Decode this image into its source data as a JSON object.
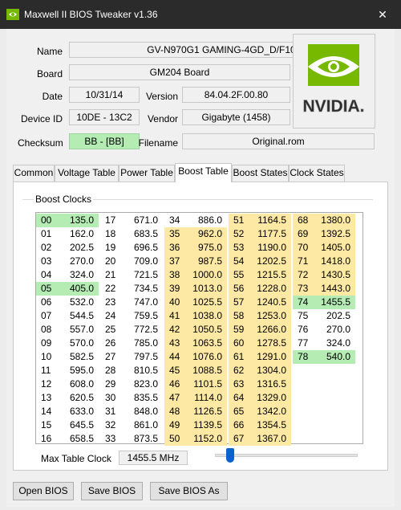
{
  "window": {
    "title": "Maxwell II BIOS Tweaker v1.36",
    "close_glyph": "✕"
  },
  "info": {
    "name_label": "Name",
    "name_value": "GV-N970G1 GAMING-4GD_D/F10",
    "board_label": "Board",
    "board_value": "GM204 Board",
    "date_label": "Date",
    "date_value": "10/31/14",
    "version_label": "Version",
    "version_value": "84.04.2F.00.80",
    "device_label": "Device ID",
    "device_value": "10DE - 13C2",
    "vendor_label": "Vendor",
    "vendor_value": "Gigabyte (1458)",
    "checksum_label": "Checksum",
    "checksum_value": "BB - [BB]",
    "filename_label": "Filename",
    "filename_value": "Original.rom",
    "logo_text": "NVIDIA."
  },
  "tabs": [
    {
      "label": "Common"
    },
    {
      "label": "Voltage Table"
    },
    {
      "label": "Power Table"
    },
    {
      "label": "Boost Table"
    },
    {
      "label": "Boost States"
    },
    {
      "label": "Clock States"
    }
  ],
  "active_tab": "Boost Table",
  "boost": {
    "group_label": "Boost Clocks",
    "max_label": "Max Table Clock",
    "max_value": "1455.5 MHz",
    "slider_position_fraction": 0.08,
    "columns": [
      [
        {
          "i": "00",
          "v": "135.0",
          "c": "green"
        },
        {
          "i": "01",
          "v": "162.0",
          "c": ""
        },
        {
          "i": "02",
          "v": "202.5",
          "c": ""
        },
        {
          "i": "03",
          "v": "270.0",
          "c": ""
        },
        {
          "i": "04",
          "v": "324.0",
          "c": ""
        },
        {
          "i": "05",
          "v": "405.0",
          "c": "green"
        },
        {
          "i": "06",
          "v": "532.0",
          "c": ""
        },
        {
          "i": "07",
          "v": "544.5",
          "c": ""
        },
        {
          "i": "08",
          "v": "557.0",
          "c": ""
        },
        {
          "i": "09",
          "v": "570.0",
          "c": ""
        },
        {
          "i": "10",
          "v": "582.5",
          "c": ""
        },
        {
          "i": "11",
          "v": "595.0",
          "c": ""
        },
        {
          "i": "12",
          "v": "608.0",
          "c": ""
        },
        {
          "i": "13",
          "v": "620.5",
          "c": ""
        },
        {
          "i": "14",
          "v": "633.0",
          "c": ""
        },
        {
          "i": "15",
          "v": "645.5",
          "c": ""
        },
        {
          "i": "16",
          "v": "658.5",
          "c": ""
        }
      ],
      [
        {
          "i": "17",
          "v": "671.0",
          "c": ""
        },
        {
          "i": "18",
          "v": "683.5",
          "c": ""
        },
        {
          "i": "19",
          "v": "696.5",
          "c": ""
        },
        {
          "i": "20",
          "v": "709.0",
          "c": ""
        },
        {
          "i": "21",
          "v": "721.5",
          "c": ""
        },
        {
          "i": "22",
          "v": "734.5",
          "c": ""
        },
        {
          "i": "23",
          "v": "747.0",
          "c": ""
        },
        {
          "i": "24",
          "v": "759.5",
          "c": ""
        },
        {
          "i": "25",
          "v": "772.5",
          "c": ""
        },
        {
          "i": "26",
          "v": "785.0",
          "c": ""
        },
        {
          "i": "27",
          "v": "797.5",
          "c": ""
        },
        {
          "i": "28",
          "v": "810.5",
          "c": ""
        },
        {
          "i": "29",
          "v": "823.0",
          "c": ""
        },
        {
          "i": "30",
          "v": "835.5",
          "c": ""
        },
        {
          "i": "31",
          "v": "848.0",
          "c": ""
        },
        {
          "i": "32",
          "v": "861.0",
          "c": ""
        },
        {
          "i": "33",
          "v": "873.5",
          "c": ""
        }
      ],
      [
        {
          "i": "34",
          "v": "886.0",
          "c": ""
        },
        {
          "i": "35",
          "v": "962.0",
          "c": "yellow"
        },
        {
          "i": "36",
          "v": "975.0",
          "c": "yellow"
        },
        {
          "i": "37",
          "v": "987.5",
          "c": "yellow"
        },
        {
          "i": "38",
          "v": "1000.0",
          "c": "yellow"
        },
        {
          "i": "39",
          "v": "1013.0",
          "c": "yellow"
        },
        {
          "i": "40",
          "v": "1025.5",
          "c": "yellow"
        },
        {
          "i": "41",
          "v": "1038.0",
          "c": "yellow"
        },
        {
          "i": "42",
          "v": "1050.5",
          "c": "yellow"
        },
        {
          "i": "43",
          "v": "1063.5",
          "c": "yellow"
        },
        {
          "i": "44",
          "v": "1076.0",
          "c": "yellow"
        },
        {
          "i": "45",
          "v": "1088.5",
          "c": "yellow"
        },
        {
          "i": "46",
          "v": "1101.5",
          "c": "yellow"
        },
        {
          "i": "47",
          "v": "1114.0",
          "c": "yellow"
        },
        {
          "i": "48",
          "v": "1126.5",
          "c": "yellow"
        },
        {
          "i": "49",
          "v": "1139.5",
          "c": "yellow"
        },
        {
          "i": "50",
          "v": "1152.0",
          "c": "yellow"
        }
      ],
      [
        {
          "i": "51",
          "v": "1164.5",
          "c": "yellow"
        },
        {
          "i": "52",
          "v": "1177.5",
          "c": "yellow"
        },
        {
          "i": "53",
          "v": "1190.0",
          "c": "yellow"
        },
        {
          "i": "54",
          "v": "1202.5",
          "c": "yellow"
        },
        {
          "i": "55",
          "v": "1215.5",
          "c": "yellow"
        },
        {
          "i": "56",
          "v": "1228.0",
          "c": "yellow"
        },
        {
          "i": "57",
          "v": "1240.5",
          "c": "yellow"
        },
        {
          "i": "58",
          "v": "1253.0",
          "c": "yellow"
        },
        {
          "i": "59",
          "v": "1266.0",
          "c": "yellow"
        },
        {
          "i": "60",
          "v": "1278.5",
          "c": "yellow"
        },
        {
          "i": "61",
          "v": "1291.0",
          "c": "yellow"
        },
        {
          "i": "62",
          "v": "1304.0",
          "c": "yellow"
        },
        {
          "i": "63",
          "v": "1316.5",
          "c": "yellow"
        },
        {
          "i": "64",
          "v": "1329.0",
          "c": "yellow"
        },
        {
          "i": "65",
          "v": "1342.0",
          "c": "yellow"
        },
        {
          "i": "66",
          "v": "1354.5",
          "c": "yellow"
        },
        {
          "i": "67",
          "v": "1367.0",
          "c": "yellow"
        }
      ],
      [
        {
          "i": "68",
          "v": "1380.0",
          "c": "yellow"
        },
        {
          "i": "69",
          "v": "1392.5",
          "c": "yellow"
        },
        {
          "i": "70",
          "v": "1405.0",
          "c": "yellow"
        },
        {
          "i": "71",
          "v": "1418.0",
          "c": "yellow"
        },
        {
          "i": "72",
          "v": "1430.5",
          "c": "yellow"
        },
        {
          "i": "73",
          "v": "1443.0",
          "c": "yellow"
        },
        {
          "i": "74",
          "v": "1455.5",
          "c": "green"
        },
        {
          "i": "75",
          "v": "202.5",
          "c": ""
        },
        {
          "i": "76",
          "v": "270.0",
          "c": ""
        },
        {
          "i": "77",
          "v": "324.0",
          "c": ""
        },
        {
          "i": "78",
          "v": "540.0",
          "c": "green"
        }
      ]
    ]
  },
  "buttons": {
    "open": "Open BIOS",
    "save": "Save BIOS",
    "save_as": "Save BIOS As"
  },
  "colors": {
    "titlebar": "#2b2b2b",
    "cell_green": "#b4ecb4",
    "cell_yellow": "#fde9a3",
    "accent": "#0a62d1"
  }
}
